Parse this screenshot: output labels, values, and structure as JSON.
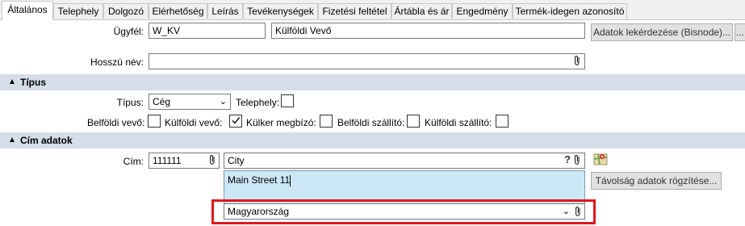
{
  "tabs": [
    {
      "label": "Általános",
      "active": true
    },
    {
      "label": "Telephely"
    },
    {
      "label": "Dolgozó"
    },
    {
      "label": "Elérhetőség"
    },
    {
      "label": "Leírás"
    },
    {
      "label": "Tevékenységek"
    },
    {
      "label": "Fizetési feltétel"
    },
    {
      "label": "Ártábla és ár"
    },
    {
      "label": "Engedmény"
    },
    {
      "label": "Termék-idegen azonosító"
    }
  ],
  "customer": {
    "label": "Ügyfél:",
    "code": "W_KV",
    "name": "Külföldi Vevő",
    "fetch_button": "Adatok lekérdezése (Bisnode)...",
    "more_button": "..."
  },
  "long_name": {
    "label": "Hosszú név:",
    "value": ""
  },
  "type_section": {
    "title": "Típus",
    "type_label": "Típus:",
    "type_value": "Cég",
    "site_label": "Telephely:",
    "site_checked": false,
    "checks": [
      {
        "label": "Belföldi vevő:",
        "checked": false
      },
      {
        "label": "Külföldi vevő:",
        "checked": true
      },
      {
        "label": "Külker megbízó:",
        "checked": false
      },
      {
        "label": "Belföldi szállító:",
        "checked": false
      },
      {
        "label": "Külföldi szállító:",
        "checked": false
      }
    ]
  },
  "address_section": {
    "title": "Cím adatok",
    "address_label": "Cím:",
    "postal_code": "111111",
    "city": "City",
    "help_glyph": "?",
    "street": "Main Street 11",
    "distance_button": "Távolság adatok rögzítése...",
    "country": "Magyarország"
  },
  "colors": {
    "highlight": "#e0161e",
    "section_bg": "#d4dde8",
    "street_bg": "#cce8f7"
  }
}
